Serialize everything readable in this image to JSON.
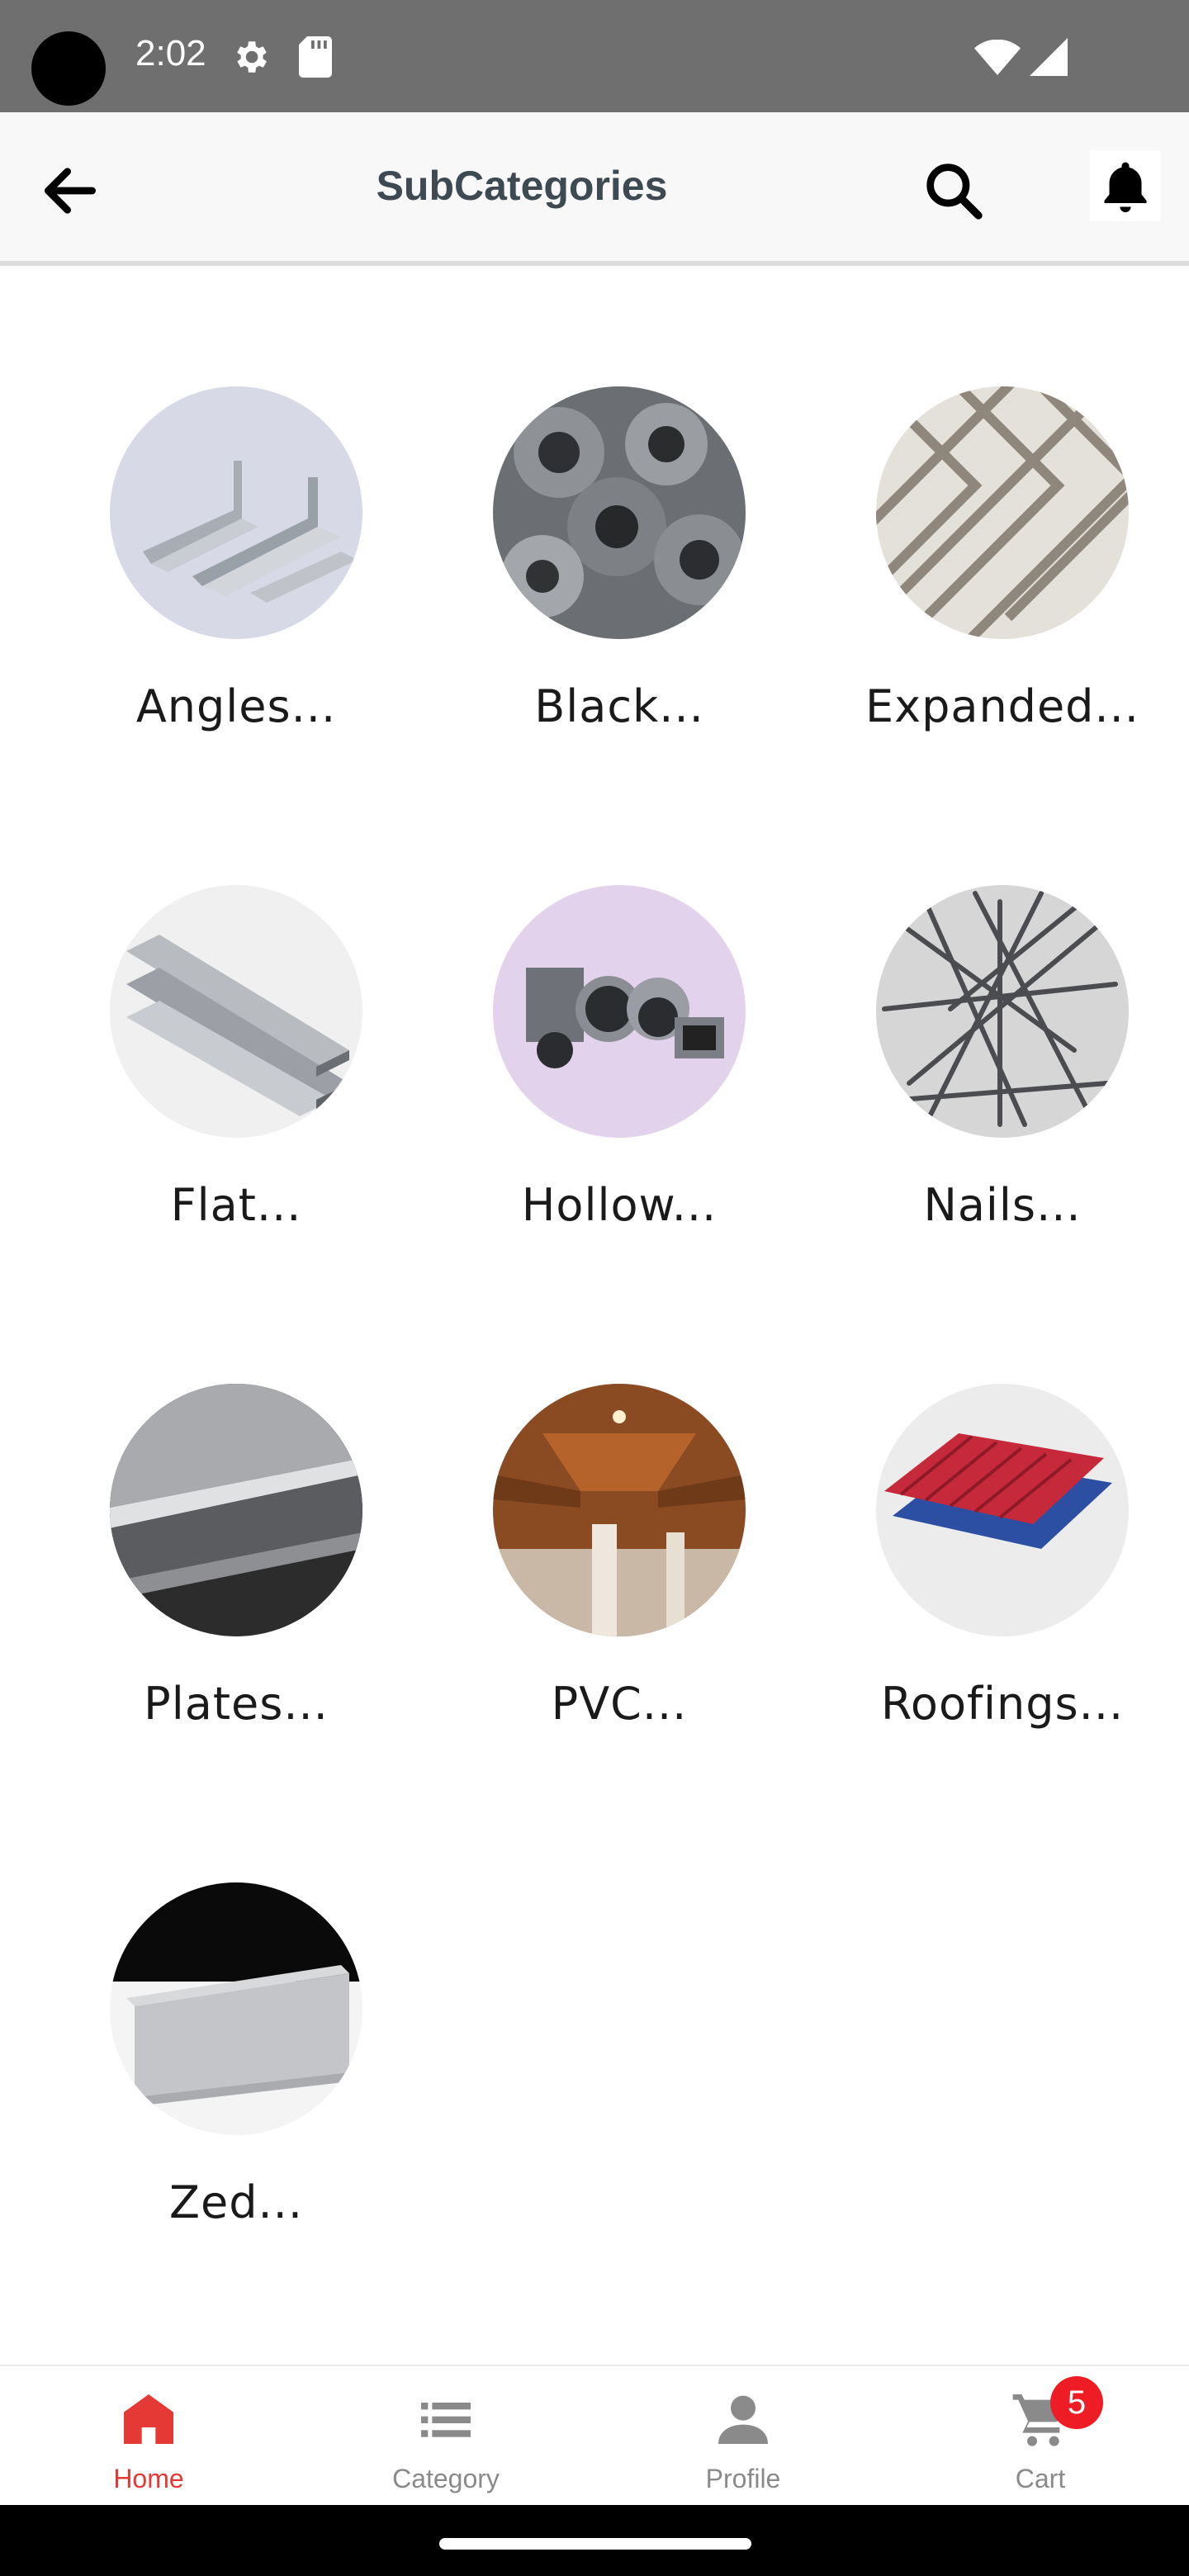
{
  "status_bar": {
    "time": "2:02"
  },
  "app_bar": {
    "title": "SubCategories"
  },
  "subcategories": [
    {
      "label": "Angles..."
    },
    {
      "label": "Black..."
    },
    {
      "label": "Expanded..."
    },
    {
      "label": "Flat..."
    },
    {
      "label": "Hollow..."
    },
    {
      "label": "Nails..."
    },
    {
      "label": "Plates..."
    },
    {
      "label": "PVC..."
    },
    {
      "label": "Roofings..."
    },
    {
      "label": "Zed..."
    }
  ],
  "bottom_nav": {
    "items": [
      {
        "label": "Home",
        "icon": "home-icon",
        "active": true
      },
      {
        "label": "Category",
        "icon": "list-icon",
        "active": false
      },
      {
        "label": "Profile",
        "icon": "person-icon",
        "active": false
      },
      {
        "label": "Cart",
        "icon": "cart-icon",
        "active": false
      }
    ],
    "cart_count": "5"
  },
  "colors": {
    "accent": "#e53935",
    "badge": "#ee1c25",
    "title": "#3d4a52"
  }
}
